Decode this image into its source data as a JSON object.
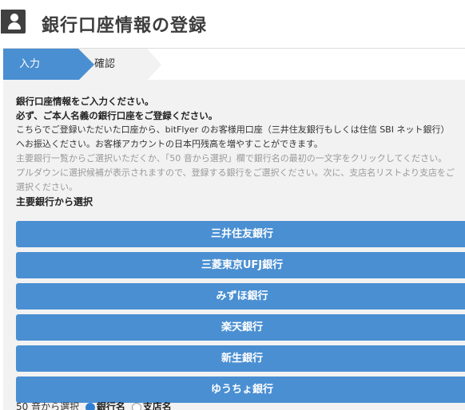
{
  "header": {
    "title": "銀行口座情報の登録",
    "icon": "account-icon"
  },
  "steps": [
    {
      "label": "入力",
      "active": true
    },
    {
      "label": "確認",
      "active": false
    }
  ],
  "intro": {
    "line1": "銀行口座情報をご入力ください。",
    "line2": "必ず、ご本人名義の銀行口座をご登録ください。",
    "line3": "こちらでご登録いただいた口座から、bitFlyer のお客様用口座（三井住友銀行もしくは住信 SBI ネット銀行）",
    "line4": "へお振込ください。お客様アカウントの日本円残高を増やすことができます。",
    "line5": "主要銀行一覧からご選択いただくか、「50 音から選択」欄で銀行名の最初の一文字をクリックしてください。",
    "line6": "プルダウンに選択候補が表示されますので、登録する銀行をご選択ください。次に、支店名リストより支店をご",
    "line7": "選択ください。"
  },
  "major_banks": {
    "label": "主要銀行から選択",
    "items": [
      "三井住友銀行",
      "三菱東京UFJ銀行",
      "みずほ銀行",
      "楽天銀行",
      "新生銀行",
      "ゆうちょ銀行"
    ]
  },
  "syllabary": {
    "label": "50 音から選択",
    "option_bank": "銀行名",
    "option_branch": "支店名",
    "selected": "銀行名"
  },
  "colors": {
    "accent": "#4a8fd2",
    "panel_bg": "#f2f2f2"
  }
}
